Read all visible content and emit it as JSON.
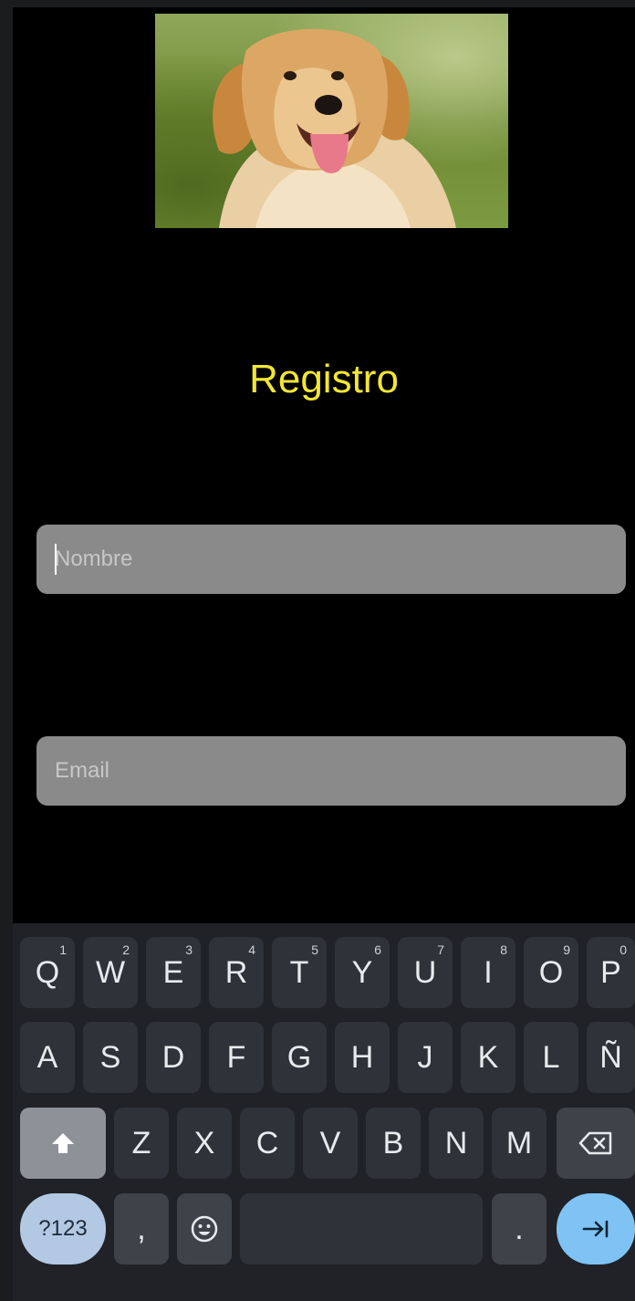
{
  "register": {
    "title": "Registro",
    "name_placeholder": "Nombre",
    "email_placeholder": "Email"
  },
  "keyboard": {
    "row1": [
      {
        "label": "Q",
        "hint": "1"
      },
      {
        "label": "W",
        "hint": "2"
      },
      {
        "label": "E",
        "hint": "3"
      },
      {
        "label": "R",
        "hint": "4"
      },
      {
        "label": "T",
        "hint": "5"
      },
      {
        "label": "Y",
        "hint": "6"
      },
      {
        "label": "U",
        "hint": "7"
      },
      {
        "label": "I",
        "hint": "8"
      },
      {
        "label": "O",
        "hint": "9"
      },
      {
        "label": "P",
        "hint": "0"
      }
    ],
    "row2": [
      "A",
      "S",
      "D",
      "F",
      "G",
      "H",
      "J",
      "K",
      "L",
      "Ñ"
    ],
    "row3": [
      "Z",
      "X",
      "C",
      "V",
      "B",
      "N",
      "M"
    ],
    "symbols_label": "?123",
    "comma_label": ",",
    "period_label": ".",
    "icons": {
      "shift": "shift-icon",
      "backspace": "backspace-icon",
      "emoji": "emoji-icon",
      "next": "tab-next-icon"
    }
  },
  "colors": {
    "title": "#f2e633",
    "field_bg": "#8a8a8a",
    "keyboard_bg": "#202227",
    "key_bg": "#2f3238",
    "enter_key": "#7ec3f3",
    "symbols_key": "#b3c9e3"
  }
}
